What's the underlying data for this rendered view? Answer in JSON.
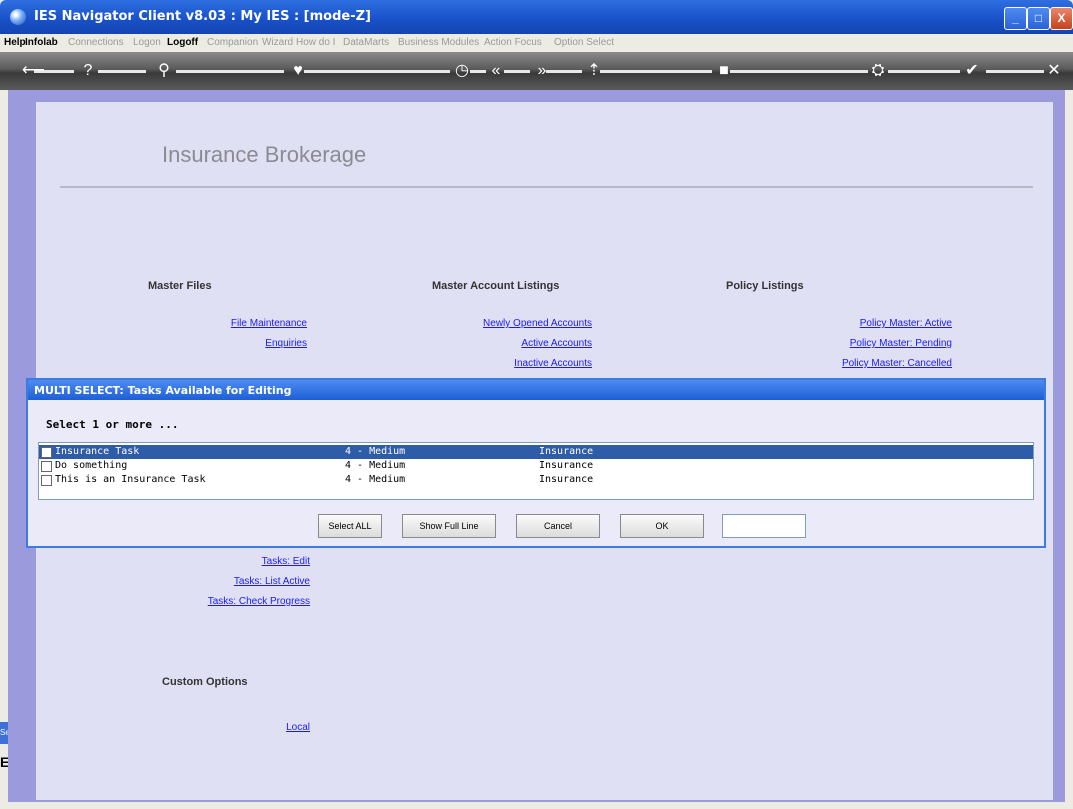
{
  "window": {
    "title": "IES Navigator Client v8.03 : My IES :      [mode-Z]",
    "controls": [
      "_",
      "□",
      "X"
    ]
  },
  "menu": [
    {
      "label": "Help",
      "active": true
    },
    {
      "label": "Infolab",
      "active": true
    },
    {
      "label": "Connections",
      "active": false
    },
    {
      "label": "Logon",
      "active": false
    },
    {
      "label": "Logoff",
      "active": true
    },
    {
      "label": "Companion",
      "active": false
    },
    {
      "label": "Wizard",
      "active": false
    },
    {
      "label": "How do I",
      "active": false
    },
    {
      "label": "DataMarts",
      "active": false
    },
    {
      "label": "Business Modules",
      "active": false
    },
    {
      "label": "Action Focus",
      "active": false
    },
    {
      "label": "Option Select",
      "active": false
    }
  ],
  "toolbar_icons": {
    "back": "⟵",
    "help": "?",
    "search": "⚲",
    "heart": "♥",
    "clock": "◷",
    "prev": "«",
    "next": "»",
    "up": "⇡",
    "stop": "■",
    "cart": "⛭",
    "check": "✔",
    "close": "✕"
  },
  "page": {
    "heading": "Insurance Brokerage",
    "columns": {
      "master_files": {
        "header": "Master Files",
        "links": [
          "File Maintenance",
          "Enquiries"
        ]
      },
      "master_accounts": {
        "header": "Master Account Listings",
        "links": [
          "Newly Opened Accounts",
          "Active Accounts",
          "Inactive Accounts"
        ]
      },
      "policy": {
        "header": "Policy Listings",
        "links": [
          "Policy Master: Active",
          "Policy Master: Pending",
          "Policy Master: Cancelled"
        ]
      }
    },
    "tasks_links": [
      "Tasks: Edit",
      "Tasks: List Active",
      "Tasks: Check Progress"
    ],
    "custom": {
      "header": "Custom Options",
      "link": "Local"
    },
    "side_tab": "Se",
    "side_glyph": "E"
  },
  "dialog": {
    "title": "MULTI SELECT: Tasks Available for Editing",
    "subtitle": "Select 1 or more ...",
    "rows": [
      {
        "name": "Insurance Task",
        "priority": "4 - Medium",
        "category": "Insurance",
        "selected": true
      },
      {
        "name": "Do something",
        "priority": "4 - Medium",
        "category": "Insurance",
        "selected": false
      },
      {
        "name": "This is an Insurance Task",
        "priority": "4 - Medium",
        "category": "Insurance",
        "selected": false
      }
    ],
    "buttons": {
      "select_all": "Select ALL",
      "show_full_line": "Show Full Line",
      "cancel": "Cancel",
      "ok": "OK"
    },
    "input_value": ""
  }
}
